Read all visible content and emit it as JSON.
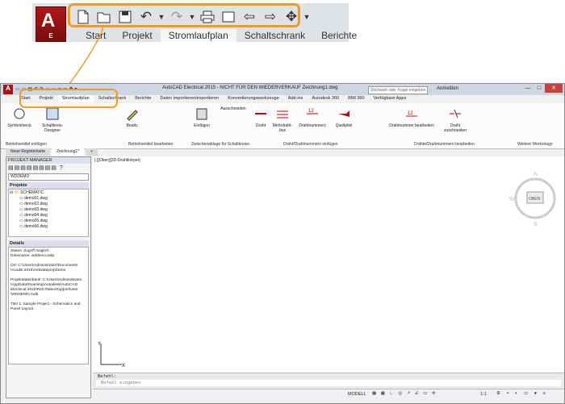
{
  "zoom": {
    "logo_letter": "E",
    "tabs": [
      "Start",
      "Projekt",
      "Stromlaufplan",
      "Schaltschrank",
      "Berichte"
    ],
    "active_tab": "Stromlaufplan"
  },
  "app": {
    "title": "AutoCAD Electrical 2015 - NICHT FÜR DEN WIEDERVERKAUF   Zeichnung1.dwg",
    "search_placeholder": "Stichwort oder Frage eingeben",
    "sign_in": "Anmelden",
    "ribbon_tabs": [
      "Start",
      "Projekt",
      "Stromlaufplan",
      "Schaltschrank",
      "Berichte",
      "Daten importieren/exportieren",
      "Konvertierungswerkzeuge",
      "Add-ins",
      "Autodesk 360",
      "BIM 360",
      "Verfügbare Apps"
    ],
    "ribbon_buttons": {
      "symbolmenu": "Symbolmenü",
      "schaltkreis": "Schaltkreis-Designer",
      "bearb": "Bearb.",
      "einfuegen": "Einfügen",
      "ausschneiden": "Ausschneiden",
      "draht": "Draht",
      "mehrdraht": "Mehrdraht-bus",
      "drahtnummern": "Drahtnummern",
      "quellpfeil": "Quellpfeil",
      "drahtnr_bearb": "Drahtnummer bearbeiten",
      "draht_zuschneiden": "Draht zuschneiden"
    },
    "panels": [
      "Betriebsmittel einfügen",
      "Betriebsmittel bearbeiten",
      "Zwischenablage für Schaltkreise",
      "Draht/Drahtnummern einfügen",
      "Drähte/Drahtnummern bearbeiten",
      "Weitere Werkzeuge"
    ],
    "doc_tabs": [
      "Neue Registerkarte",
      "Zeichnung1*"
    ],
    "viewport_label": "[-][Oben][2D-Drahtkörper]",
    "project_manager": {
      "title": "PROJEKT-MANAGER",
      "selected_project": "WDDEMO",
      "projects_label": "Projekte",
      "root": "SCHEMATIC",
      "files": [
        "demo01.dwg",
        "demo02.dwg",
        "demo03.dwg",
        "demo04.dwg",
        "demo05.dwg",
        "demo06.dwg"
      ],
      "details_label": "Details",
      "details": [
        "Status: Zugriff möglich",
        "Dateiname: wddemo.wdp",
        "",
        "Ort: C:\\Users\\Administrator\\Documents",
        "\\AcadE 2015\\AeData\\proj\\Demo",
        "",
        "Projektdatenbank: C:\\Users\\Administrator",
        "\\AppData\\Roaming\\Autodesk\\AutoCAD",
        "Electrical 2015\\R20.0\\deu\\Support\\user",
        "\\WDDEMO.mdb",
        "",
        "Titel 1: Sample Project - Schematics and",
        "Panel Layout"
      ]
    },
    "viewcube": {
      "n": "N",
      "s": "S",
      "w": "W",
      "face": "OBEN",
      "wcs": "WKS"
    },
    "command": {
      "label": "Befehl:",
      "placeholder": "Befehl eingeben"
    },
    "status": {
      "model": "MODELL",
      "scale": "1:1"
    }
  }
}
